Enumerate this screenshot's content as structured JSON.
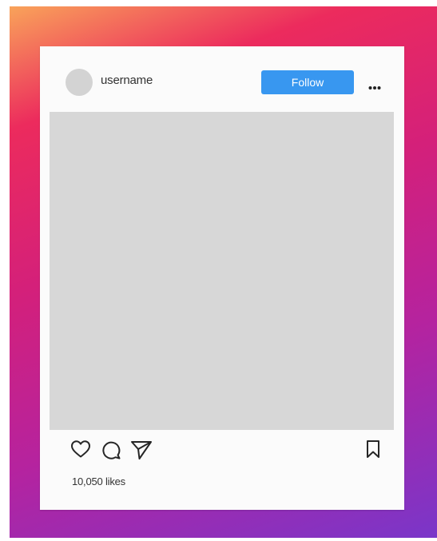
{
  "post": {
    "username": "username",
    "follow_label": "Follow",
    "likes_text": "10,050 likes"
  },
  "icons": {
    "avatar": "avatar-placeholder",
    "more": "more-dots-icon",
    "like": "heart-icon",
    "comment": "comment-bubble-icon",
    "share": "paper-plane-icon",
    "save": "bookmark-icon"
  },
  "colors": {
    "follow_button": "#3897f0",
    "photo_placeholder": "#d7d7d7",
    "avatar_placeholder": "#d3d3d3",
    "card_background": "#fbfbfb",
    "frame_gradient_start": "#f9a35a",
    "frame_gradient_mid": "#d4207a",
    "frame_gradient_end": "#7a36c9"
  }
}
